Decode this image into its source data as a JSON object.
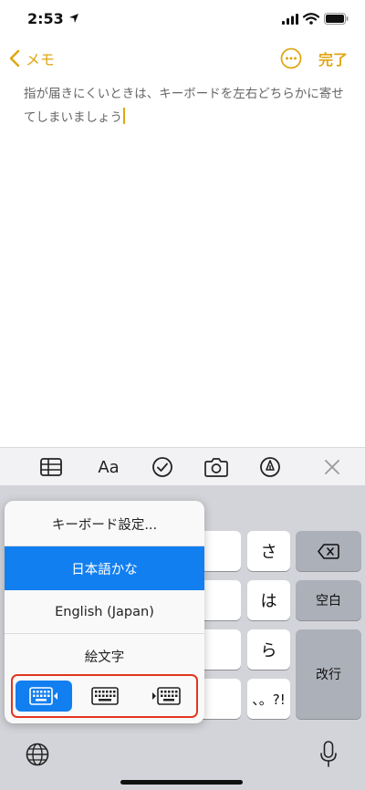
{
  "status_bar": {
    "time": "2:53"
  },
  "nav": {
    "back_label": "メモ",
    "done_label": "完了"
  },
  "note": {
    "text": "指が届きにくいときは、キーボードを左右どちらかに寄せてしまいましょう"
  },
  "toolbar": {
    "format_label": "Aa"
  },
  "keyboard": {
    "keys": {
      "sa": "さ",
      "ha": "は",
      "ra": "ら",
      "punct": "、。?!"
    },
    "space_label": "空白",
    "return_label": "改行"
  },
  "popup": {
    "items": [
      "キーボード設定...",
      "日本語かな",
      "English (Japan)",
      "絵文字"
    ],
    "selected_index": 1,
    "keyboard_positions": [
      "left",
      "center",
      "right"
    ],
    "active_position": "left"
  },
  "colors": {
    "accent": "#e0a714",
    "selection": "#127ff0",
    "highlight": "#e2361e"
  }
}
